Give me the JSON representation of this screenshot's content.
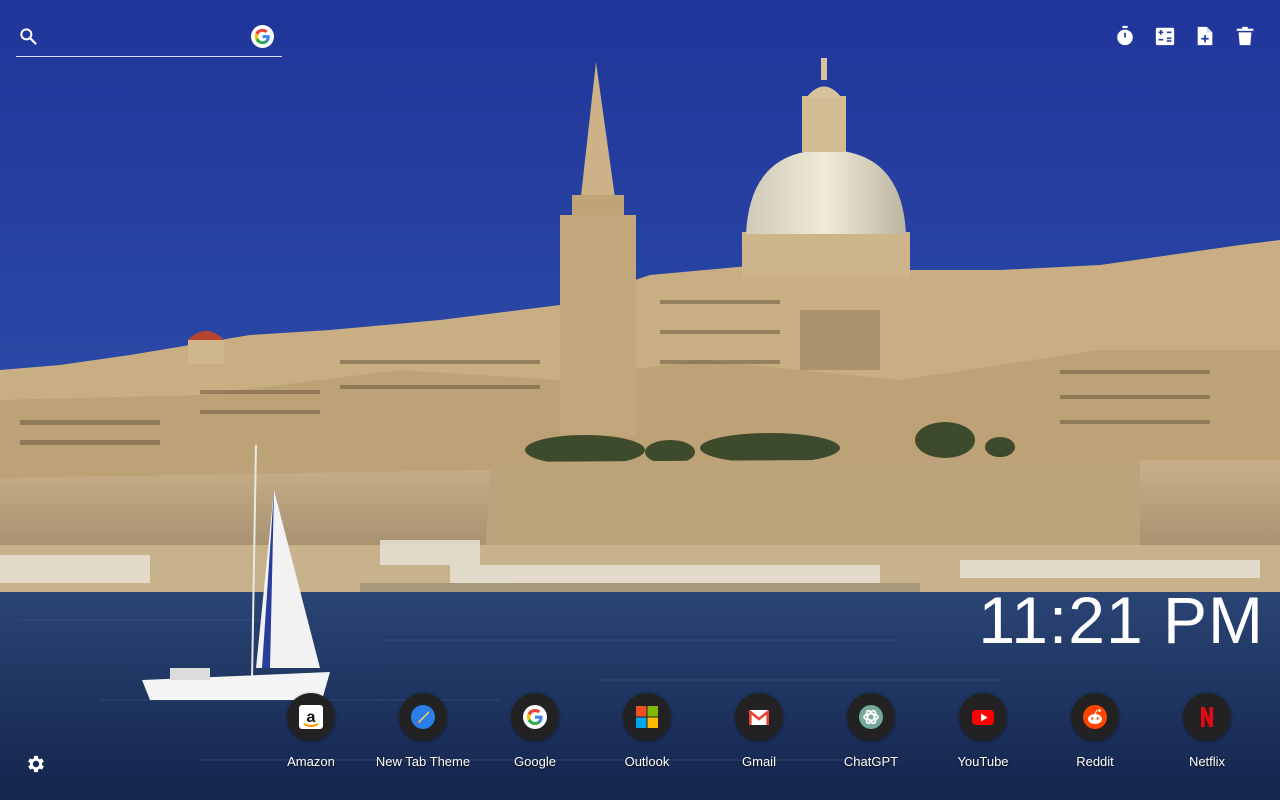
{
  "search": {
    "placeholder": "",
    "icon": "search-icon",
    "engine_icon": "google-logo-icon"
  },
  "toolbar": {
    "items": [
      {
        "icon": "timer-icon"
      },
      {
        "icon": "calculator-icon"
      },
      {
        "icon": "note-add-icon"
      },
      {
        "icon": "trash-icon"
      }
    ]
  },
  "clock": {
    "time": "11:21 PM"
  },
  "shortcuts": [
    {
      "label": "Amazon",
      "icon": "amazon-icon"
    },
    {
      "label": "New Tab Theme",
      "icon": "new-tab-theme-icon"
    },
    {
      "label": "Google",
      "icon": "google-icon"
    },
    {
      "label": "Outlook",
      "icon": "microsoft-icon"
    },
    {
      "label": "Gmail",
      "icon": "gmail-icon"
    },
    {
      "label": "ChatGPT",
      "icon": "chatgpt-icon"
    },
    {
      "label": "YouTube",
      "icon": "youtube-icon"
    },
    {
      "label": "Reddit",
      "icon": "reddit-icon"
    },
    {
      "label": "Netflix",
      "icon": "netflix-icon"
    }
  ],
  "settings": {
    "icon": "gear-icon"
  },
  "colors": {
    "sky": "#2a3f9c",
    "stone": "#c7ae82",
    "water": "#1c3060",
    "text": "#ffffff"
  }
}
